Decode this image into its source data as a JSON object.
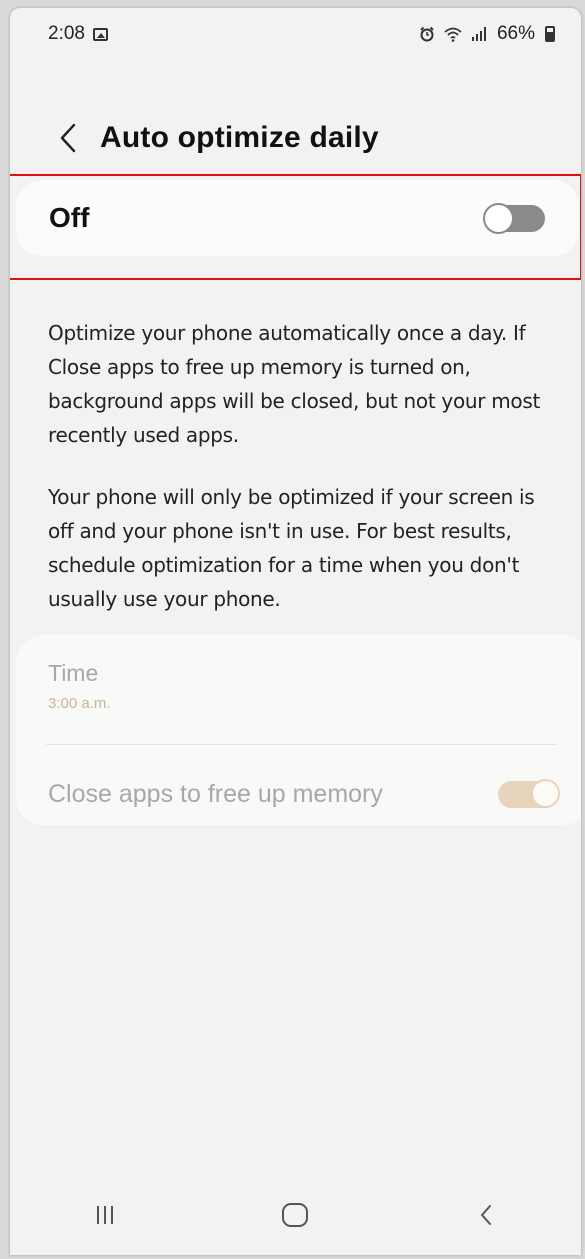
{
  "status_bar": {
    "time": "2:08",
    "battery": "66%",
    "icons": [
      "image-notification-icon",
      "alarm-icon",
      "wifi-icon",
      "signal-icon",
      "battery-icon"
    ]
  },
  "header": {
    "title": "Auto optimize daily",
    "back_icon": "chevron-left-icon"
  },
  "master_switch": {
    "label": "Off",
    "state": "off"
  },
  "description": {
    "paragraph1": "Optimize your phone automatically once a day. If Close apps to free up memory is turned on, background apps will be closed, but not your most recently used apps.",
    "paragraph2": "Your phone will only be optimized if your screen is off and your phone isn't in use. For best results, schedule optimization for a time when you don't usually use your phone."
  },
  "settings": {
    "time_label": "Time",
    "time_value": "3:00 a.m.",
    "close_apps_label": "Close apps to free up memory",
    "close_apps_state": "on",
    "disabled": true
  },
  "nav_bar": {
    "buttons": [
      "recents-icon",
      "home-icon",
      "back-icon"
    ]
  },
  "colors": {
    "background": "#f2f2f0",
    "card": "#fbfbfa",
    "highlight": "#e01010",
    "switch_off": "#8a8a8a",
    "switch_on_disabled": "#e8d4bd",
    "disabled_text": "#a8a8a8",
    "disabled_accent": "#c9b49a"
  }
}
